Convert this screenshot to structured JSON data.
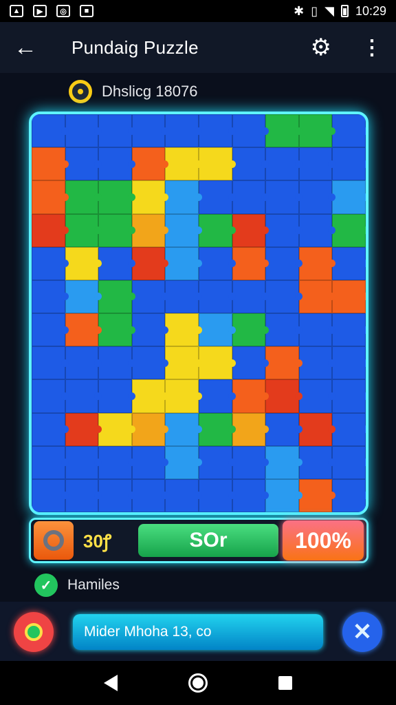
{
  "status": {
    "time": "10:29"
  },
  "header": {
    "title": "Pundaig Puzzle"
  },
  "score": {
    "text": "Dhslicg 18076"
  },
  "board": {
    "colors": {
      "B": "#1e5be6",
      "L": "#2a9bf0",
      "O": "#f4601c",
      "R": "#e33b1c",
      "Y": "#f5d91c",
      "G": "#22b845",
      "A": "#f2a51a"
    },
    "rows": [
      "BBBBBBBGGB",
      "OBBOYYBBBB",
      "OGGYLBBBBL",
      "RGGALGRBBG",
      "BYBRLBOBOB",
      "BLGBBBBBOO",
      "BOGBYLGBBB",
      "BBBBYYBOBB",
      "BBBYYBORBB",
      "BRYALGABRB",
      "BBBBLBBLBB",
      "BBBBBBBLOB"
    ]
  },
  "controls": {
    "moves": "30ꝭ",
    "green_label": "SOr",
    "progress": "100%"
  },
  "hint": {
    "text": "Hamiles"
  },
  "message": {
    "text": "Mider Mhoha 13, co"
  },
  "icons": [
    "back-arrow-icon",
    "gear-icon",
    "more-vert-icon",
    "target-icon",
    "check-icon",
    "pin-icon",
    "close-icon"
  ]
}
